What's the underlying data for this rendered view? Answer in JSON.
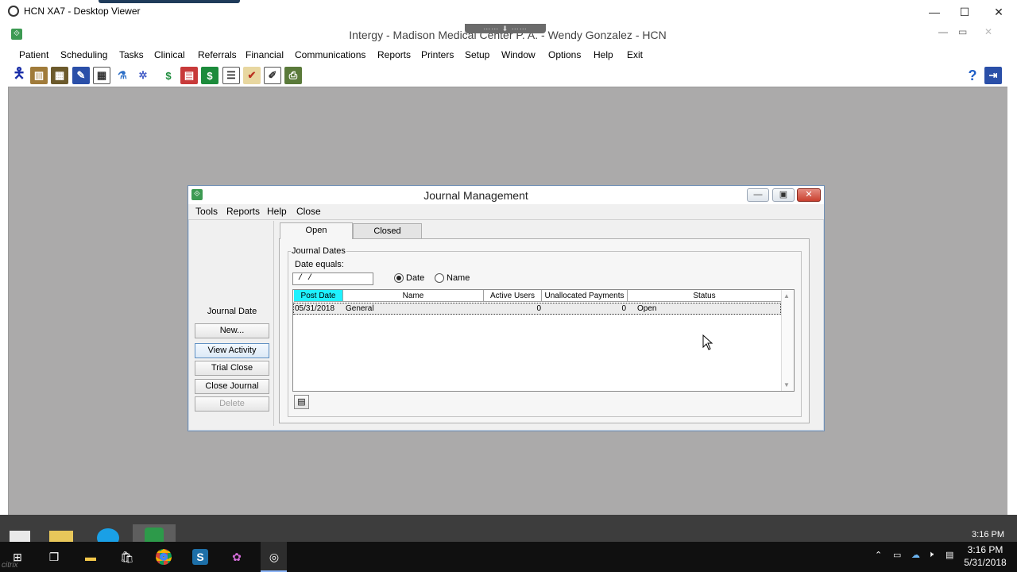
{
  "viewer": {
    "title": "HCN XA7 - Desktop Viewer",
    "controls": {
      "minimize": "—",
      "maximize": "☐",
      "close": "✕"
    }
  },
  "app": {
    "title": "Intergy - Madison Medical Center P. A. - Wendy Gonzalez - HCN",
    "menu": [
      "Patient",
      "Scheduling",
      "Tasks",
      "Clinical",
      "Referrals",
      "Financial",
      "Communications",
      "Reports",
      "Printers",
      "Setup",
      "Window",
      "Options",
      "Help",
      "Exit"
    ],
    "toolbar_icons": [
      "person-icon",
      "books-icon",
      "schedule-icon",
      "clipboard-icon",
      "calendar-grid-icon",
      "flask-icon",
      "gear-icon",
      "money-icon",
      "form-icon",
      "dollar-icon",
      "list-icon",
      "checklist-icon",
      "edit-note-icon",
      "printer-icon"
    ],
    "help_icon": "?"
  },
  "journal": {
    "title": "Journal Management",
    "menu": [
      "Tools",
      "Reports",
      "Help",
      "Close"
    ],
    "side_label": "Journal Date",
    "buttons": {
      "new": "New...",
      "view_activity": "View Activity",
      "trial_close": "Trial Close",
      "close_journal": "Close Journal",
      "delete": "Delete"
    },
    "tabs": {
      "open": "Open",
      "closed": "Closed"
    },
    "group_title": "Journal Dates",
    "date_equals_label": "Date equals:",
    "date_input_value": " /  /",
    "radios": {
      "date": "Date",
      "name": "Name",
      "selected": "Date"
    },
    "columns": [
      "Post Date",
      "Name",
      "Active Users",
      "Unallocated Payments",
      "Status"
    ],
    "rows": [
      {
        "post_date": "05/31/2018",
        "name": "General",
        "active_users": "0",
        "unallocated_payments": "0",
        "status": "Open"
      }
    ]
  },
  "taskbar": {
    "inner_clock": "3:16 PM",
    "time": "3:16 PM",
    "date": "5/31/2018",
    "citrix_tag": "citrix"
  },
  "colors": {
    "app_background": "#abaaaa",
    "post_date_header": "#1ff1ff",
    "close_button": "#c9402f"
  }
}
